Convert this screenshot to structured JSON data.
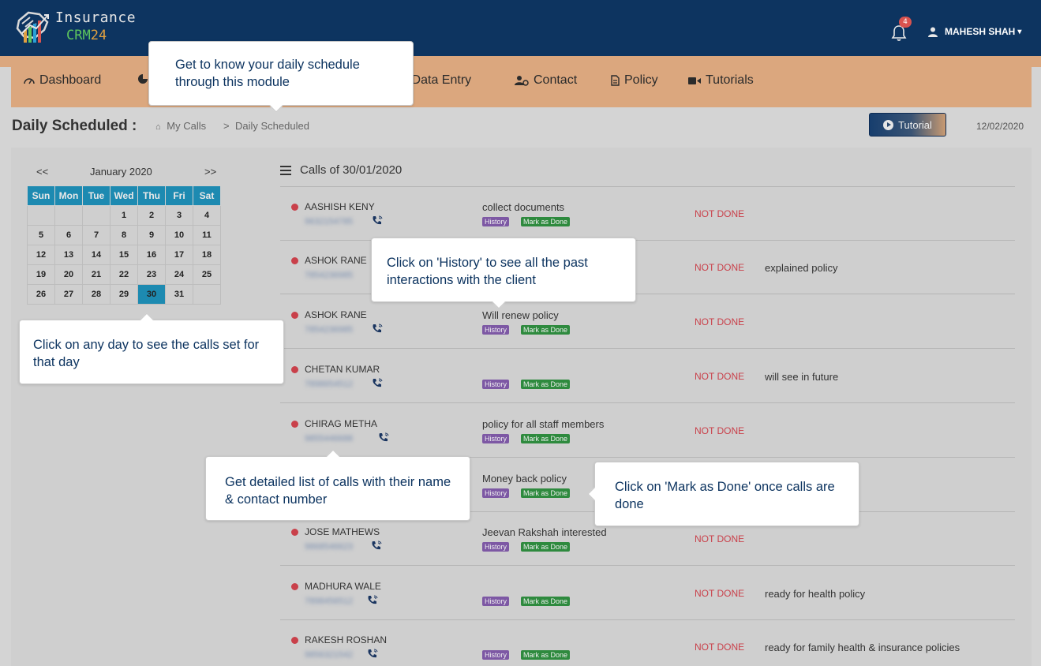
{
  "brand": {
    "line1": "Insurance",
    "line2_a": "CRM",
    "line2_b": "24"
  },
  "header": {
    "notification_count": "4",
    "user_name": "MAHESH SHAH"
  },
  "nav": {
    "dashboard": "Dashboard",
    "data_entry": "ll Data Entry",
    "contact": "Contact",
    "policy": "Policy",
    "tutorials": "Tutorials"
  },
  "page": {
    "title": "Daily Scheduled :",
    "breadcrumb_home": "My Calls",
    "breadcrumb_sep": ">",
    "breadcrumb_current": "Daily Scheduled",
    "tutorial_button": "Tutorial",
    "today": "12/02/2020"
  },
  "calendar": {
    "prev": "<<",
    "next": ">>",
    "month": "January 2020",
    "weekdays": [
      "Sun",
      "Mon",
      "Tue",
      "Wed",
      "Thu",
      "Fri",
      "Sat"
    ],
    "weeks": [
      [
        "",
        "",
        "",
        "1",
        "2",
        "3",
        "4"
      ],
      [
        "5",
        "6",
        "7",
        "8",
        "9",
        "10",
        "11"
      ],
      [
        "12",
        "13",
        "14",
        "15",
        "16",
        "17",
        "18"
      ],
      [
        "19",
        "20",
        "21",
        "22",
        "23",
        "24",
        "25"
      ],
      [
        "26",
        "27",
        "28",
        "29",
        "30",
        "31",
        ""
      ]
    ],
    "selected_day": "30"
  },
  "calls": {
    "title": "Calls of 30/01/2020",
    "history_label": "History",
    "done_label": "Mark as Done",
    "items": [
      {
        "name": "AASHISH KENY",
        "phone": "9632154785",
        "note": "collect documents",
        "status": "NOT DONE",
        "remark": ""
      },
      {
        "name": "ASHOK RANE",
        "phone": "7854236985",
        "note": "",
        "status": "NOT DONE",
        "remark": "explained policy"
      },
      {
        "name": "ASHOK RANE",
        "phone": "7854236985",
        "note": "Will renew policy",
        "status": "NOT DONE",
        "remark": ""
      },
      {
        "name": "CHETAN KUMAR",
        "phone": "7898654512",
        "note": "",
        "status": "NOT DONE",
        "remark": "will see in future"
      },
      {
        "name": "CHIRAG METHA",
        "phone": "9855446688",
        "note": "policy for all staff members",
        "status": "NOT DONE",
        "remark": ""
      },
      {
        "name": "",
        "phone": "",
        "note": "Money back policy",
        "status": "",
        "remark": ""
      },
      {
        "name": "JOSE MATHEWS",
        "phone": "9868546623",
        "note": "Jeevan Rakshah interested",
        "status": "NOT DONE",
        "remark": ""
      },
      {
        "name": "MADHURA WALE",
        "phone": "7898456512",
        "note": "",
        "status": "NOT DONE",
        "remark": "ready for health policy"
      },
      {
        "name": "RAKESH ROSHAN",
        "phone": "9856321542",
        "note": "",
        "status": "NOT DONE",
        "remark": "ready for family health & insurance policies"
      }
    ]
  },
  "tips": {
    "schedule": "Get to know your daily schedule through this module",
    "history": "Click on 'History' to see all the past interactions with the client",
    "calendar": "Click on any day to see the calls set for that day",
    "list": "Get detailed list of  calls  with their name & contact number",
    "done": "Click on 'Mark as Done' once calls are done"
  }
}
